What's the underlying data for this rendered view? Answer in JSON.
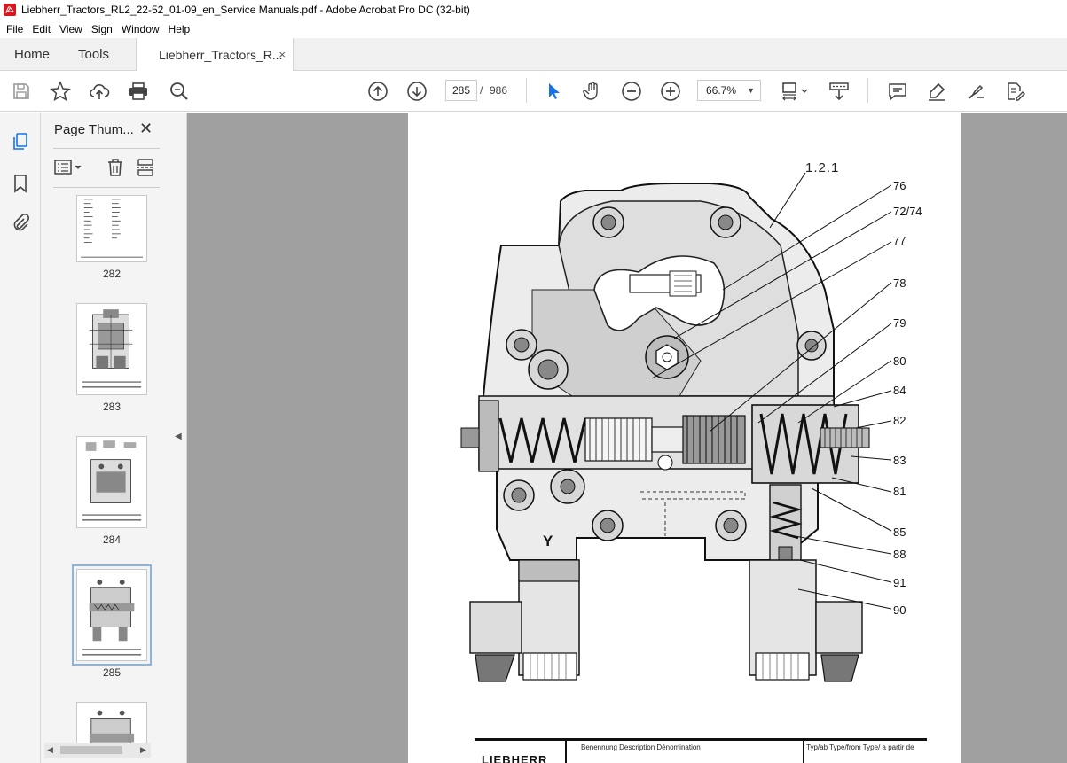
{
  "window": {
    "title": "Liebherr_Tractors_RL2_22-52_01-09_en_Service Manuals.pdf - Adobe Acrobat Pro DC (32-bit)"
  },
  "menu": [
    "File",
    "Edit",
    "View",
    "Sign",
    "Window",
    "Help"
  ],
  "tabs": {
    "home": "Home",
    "tools": "Tools",
    "document": "Liebherr_Tractors_R...",
    "close": "×"
  },
  "toolbar": {
    "current_page": "285",
    "page_separator": "/",
    "total_pages": "986",
    "zoom": "66.7%"
  },
  "panel": {
    "title": "Page Thum...",
    "close": "✕",
    "thumbnails": [
      {
        "label": "282",
        "selected": false
      },
      {
        "label": "283",
        "selected": false
      },
      {
        "label": "284",
        "selected": false
      },
      {
        "label": "285",
        "selected": true
      }
    ]
  },
  "document": {
    "figure_ref": "1.2.1",
    "callouts": [
      "76",
      "72/74",
      "77",
      "78",
      "79",
      "80",
      "84",
      "82",
      "83",
      "81",
      "85",
      "88",
      "91",
      "90"
    ],
    "view_label": "Y",
    "title_block": {
      "brand": "LIEBHERR",
      "description_header": "Benennung  Description  Dénomination",
      "type_header": "Typ/ab Type/from Type/ a partir de"
    }
  },
  "colors": {
    "accent_blue": "#1473e6",
    "doc_background": "#a0a0a0"
  }
}
